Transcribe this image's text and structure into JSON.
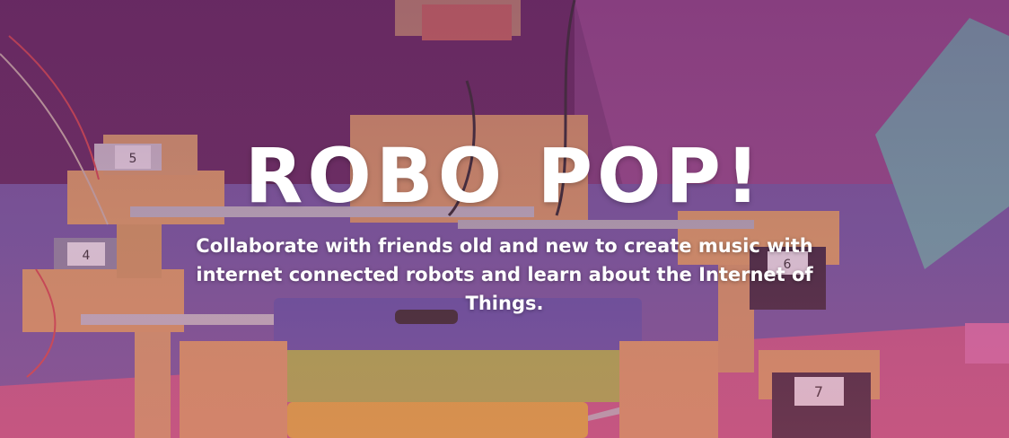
{
  "hero": {
    "title": "ROBO POP!",
    "subtitle": "Collaborate with friends old and new to create music with internet connected robots and learn about the Internet of Things.",
    "overlay_color": "#8a3c8c",
    "background_image": "photo-robots-xylophone",
    "key_labels": [
      "5",
      "4",
      "6",
      "7"
    ]
  },
  "colors": {
    "text": "#ffffff",
    "wall": "#6b2f66",
    "table": "#7a5aa8",
    "wood": "#d9a064",
    "key_blue": "#5a55a8",
    "key_green": "#a8b84a",
    "key_yellow": "#e0b23a"
  }
}
